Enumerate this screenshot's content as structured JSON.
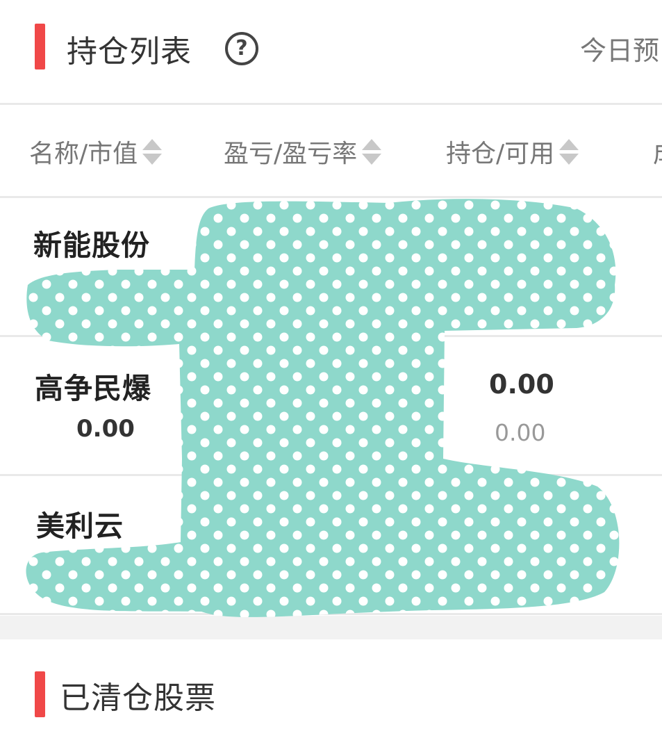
{
  "holdings": {
    "title": "持仓列表",
    "help_symbol": "?",
    "today_label": "今日预"
  },
  "columns": [
    {
      "label": "名称/市值"
    },
    {
      "label": "盈亏/盈亏率"
    },
    {
      "label": "持仓/可用"
    },
    {
      "label": "成"
    }
  ],
  "rows": [
    {
      "name": "新能股份"
    },
    {
      "name": "高争民爆",
      "market_value": "0.00",
      "position": "0.00",
      "available": "0.00"
    },
    {
      "name": "美利云"
    }
  ],
  "cleared": {
    "title": "已清仓股票"
  },
  "colors": {
    "accent": "#f04848",
    "redaction_fill": "#8ed8cb",
    "redaction_dot": "#ffffff"
  }
}
